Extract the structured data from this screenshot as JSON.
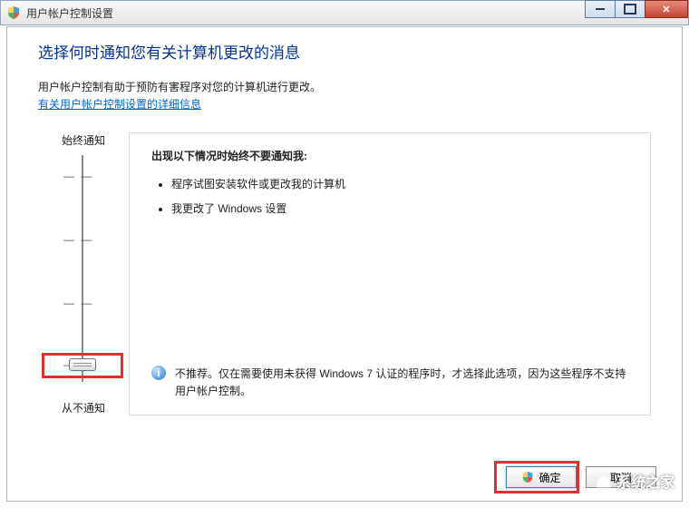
{
  "window": {
    "title": "用户帐户控制设置",
    "minimize_name": "minimize",
    "maximize_name": "maximize",
    "close_name": "close"
  },
  "header": {
    "title": "选择何时通知您有关计算机更改的消息",
    "description": "用户帐户控制有助于预防有害程序对您的计算机进行更改。",
    "help_link": "有关用户帐户控制设置的详细信息"
  },
  "slider": {
    "top_label": "始终通知",
    "bottom_label": "从不通知",
    "tick_mark": "—   —",
    "level_count": 4,
    "current_level": 1
  },
  "panel": {
    "title": "出现以下情况时始终不要通知我:",
    "bullets": [
      "程序试图安装软件或更改我的计算机",
      "我更改了 Windows 设置"
    ],
    "warning": "不推荐。仅在需要使用未获得 Windows 7 认证的程序时，才选择此选项，因为这些程序不支持用户帐户控制。"
  },
  "buttons": {
    "ok": "确定",
    "cancel": "取消"
  },
  "watermark": "系统之家"
}
